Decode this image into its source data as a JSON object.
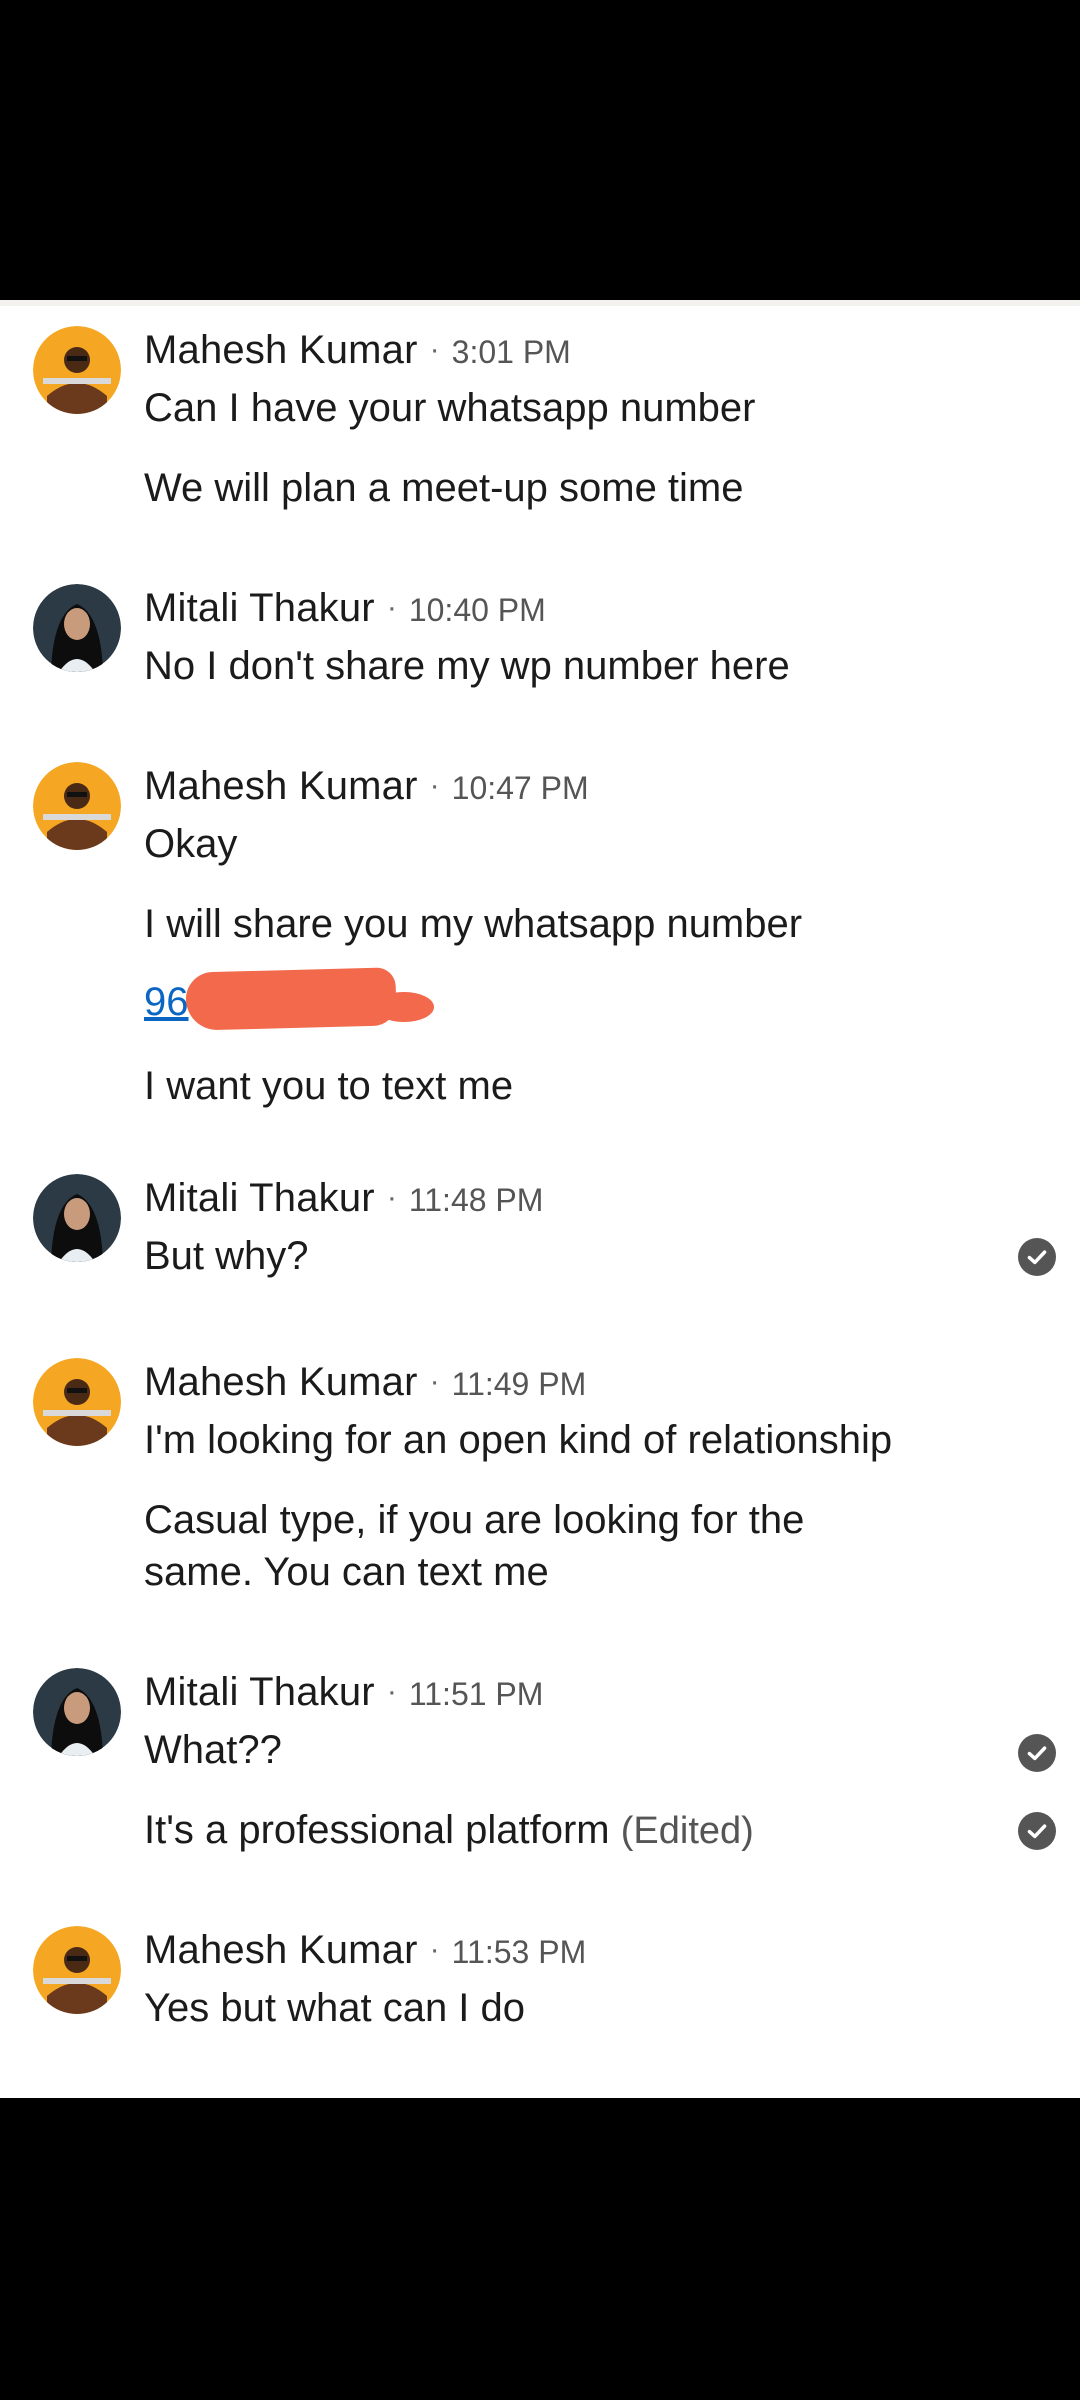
{
  "conversation": [
    {
      "sender": "Mahesh Kumar",
      "time": "3:01 PM",
      "avatar": "mahesh-avatar",
      "messages": [
        {
          "text": "Can I have your whatsapp number"
        },
        {
          "text": "We will plan a meet-up some time"
        }
      ]
    },
    {
      "sender": "Mitali Thakur",
      "time": "10:40 PM",
      "avatar": "mitali-avatar",
      "messages": [
        {
          "text": "No I don't share my wp number here"
        }
      ]
    },
    {
      "sender": "Mahesh Kumar",
      "time": "10:47 PM",
      "avatar": "mahesh-avatar",
      "messages": [
        {
          "text": "Okay"
        },
        {
          "text": "I will share you my whatsapp number"
        },
        {
          "text": "96",
          "type": "phone-link",
          "redacted": true
        },
        {
          "text": "I want you to text me"
        }
      ]
    },
    {
      "sender": "Mitali Thakur",
      "time": "11:48 PM",
      "avatar": "mitali-avatar",
      "messages": [
        {
          "text": "But why?",
          "status_icon": "read-check-icon"
        }
      ]
    },
    {
      "sender": "Mahesh Kumar",
      "time": "11:49 PM",
      "avatar": "mahesh-avatar",
      "messages": [
        {
          "text": "I'm looking for an open kind of relationship"
        },
        {
          "text": "Casual type, if you are looking for the same. You can text me"
        }
      ]
    },
    {
      "sender": "Mitali Thakur",
      "time": "11:51 PM",
      "avatar": "mitali-avatar",
      "messages": [
        {
          "text": "What??",
          "status_icon": "read-check-icon"
        },
        {
          "text": "It's a professional platform",
          "edited_label": "(Edited)",
          "status_icon": "read-check-icon"
        }
      ]
    },
    {
      "sender": "Mahesh Kumar",
      "time": "11:53 PM",
      "avatar": "mahesh-avatar",
      "messages": [
        {
          "text": "Yes but what can I do"
        }
      ]
    }
  ],
  "separator": "·",
  "colors": {
    "link": "#0a66c2",
    "redaction": "#f2694c",
    "avatar_bg_mahesh": "#f5a623",
    "read_check": "#555555"
  }
}
